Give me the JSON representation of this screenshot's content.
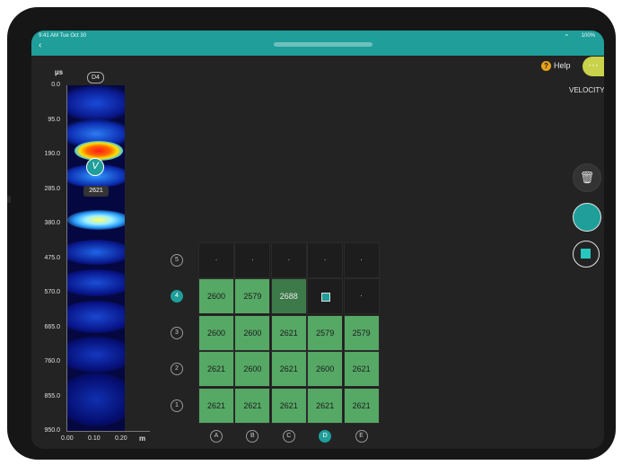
{
  "status_bar": {
    "time": "9:41 AM  Tue Oct 30",
    "battery": "100%",
    "wifi": "wifi"
  },
  "nav": {
    "back_icon": "chevron-left-icon"
  },
  "toolbar": {
    "help_label": "Help",
    "help_icon": "question-icon",
    "more_icon": "ellipsis-icon"
  },
  "mode_label": "VELOCITY",
  "scan": {
    "tag": "D4",
    "y_unit": "µs",
    "x_unit": "m",
    "y_ticks": [
      "0.0",
      "95.0",
      "190.0",
      "285.0",
      "380.0",
      "475.0",
      "570.0",
      "665.0",
      "760.0",
      "855.0",
      "950.0"
    ],
    "x_ticks": [
      "0.00",
      "0.10",
      "0.20"
    ],
    "marker_value": "2621",
    "marker_symbol": "V"
  },
  "grid": {
    "rows": [
      {
        "label": "5",
        "active": false,
        "cells": [
          "·",
          "·",
          "·",
          "·",
          "·"
        ],
        "states": [
          "empty",
          "empty",
          "empty",
          "empty",
          "empty"
        ]
      },
      {
        "label": "4",
        "active": true,
        "cells": [
          "2600",
          "2579",
          "2688",
          "",
          "·"
        ],
        "states": [
          "green",
          "green",
          "dark",
          "cur",
          "empty"
        ]
      },
      {
        "label": "3",
        "active": false,
        "cells": [
          "2600",
          "2600",
          "2621",
          "2579",
          "2579"
        ],
        "states": [
          "green",
          "green",
          "green",
          "green",
          "green"
        ]
      },
      {
        "label": "2",
        "active": false,
        "cells": [
          "2621",
          "2600",
          "2621",
          "2600",
          "2621"
        ],
        "states": [
          "green",
          "green",
          "green",
          "green",
          "green"
        ]
      },
      {
        "label": "1",
        "active": false,
        "cells": [
          "2621",
          "2621",
          "2621",
          "2621",
          "2621"
        ],
        "states": [
          "green",
          "green",
          "green",
          "green",
          "green"
        ]
      }
    ],
    "columns": [
      {
        "label": "A",
        "active": false
      },
      {
        "label": "B",
        "active": false
      },
      {
        "label": "C",
        "active": false
      },
      {
        "label": "D",
        "active": true
      },
      {
        "label": "E",
        "active": false
      }
    ]
  },
  "actions": {
    "delete_icon": "trash-icon",
    "record_icon": "record-icon",
    "stop_icon": "stop-icon"
  },
  "colors": {
    "accent": "#1f9e9a",
    "cell_green": "#56a865",
    "cell_dark": "#3d7a4a",
    "help": "#e8a21c",
    "more": "#c9d24b"
  }
}
